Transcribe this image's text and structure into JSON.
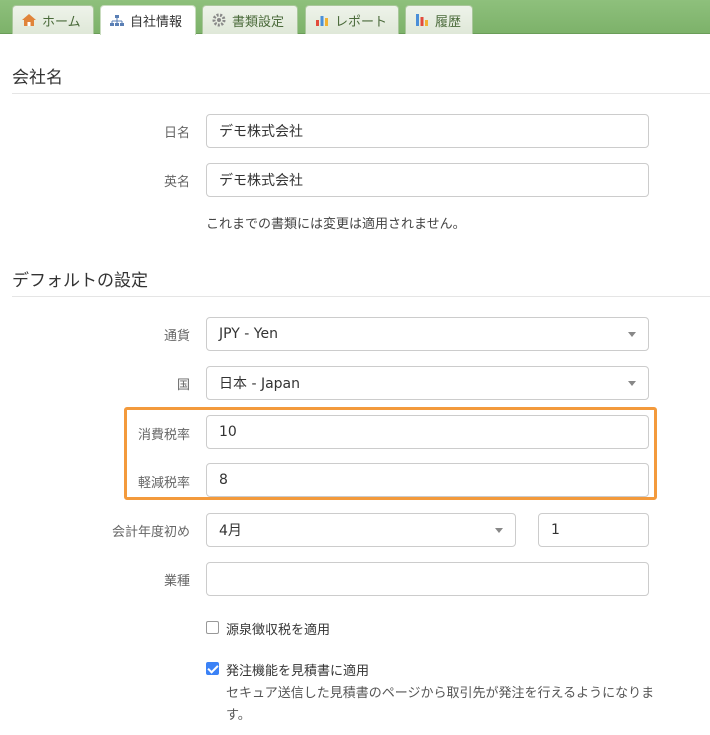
{
  "tabs": [
    {
      "label": "ホーム",
      "icon": "home-icon"
    },
    {
      "label": "自社情報",
      "icon": "org-chart-icon"
    },
    {
      "label": "書類設定",
      "icon": "gear-icon"
    },
    {
      "label": "レポート",
      "icon": "bar-chart-icon"
    },
    {
      "label": "履歴",
      "icon": "history-icon"
    }
  ],
  "company": {
    "title": "会社名",
    "japanese_label": "日名",
    "japanese_value": "デモ株式会社",
    "english_label": "英名",
    "english_value": "デモ株式会社",
    "note": "これまでの書類には変更は適用されません。"
  },
  "defaults": {
    "title": "デフォルトの設定",
    "currency_label": "通貨",
    "currency_value": "JPY - Yen",
    "country_label": "国",
    "country_value": "日本 - Japan",
    "consumption_tax_label": "消費税率",
    "consumption_tax_value": "10",
    "reduced_tax_label": "軽減税率",
    "reduced_tax_value": "8",
    "fiscal_year_label": "会計年度初め",
    "fiscal_month_value": "4月",
    "fiscal_day_value": "1",
    "industry_label": "業種",
    "industry_value": "",
    "withholding_label": "源泉徴収税を適用",
    "withholding_checked": false,
    "order_label": "発注機能を見積書に適用",
    "order_checked": true,
    "order_desc": "セキュア送信した見積書のページから取引先が発注を行えるようになります。"
  },
  "colors": {
    "highlight": "#f39a3c",
    "tabbar": "#8ec07c",
    "check": "#3b82f6"
  }
}
